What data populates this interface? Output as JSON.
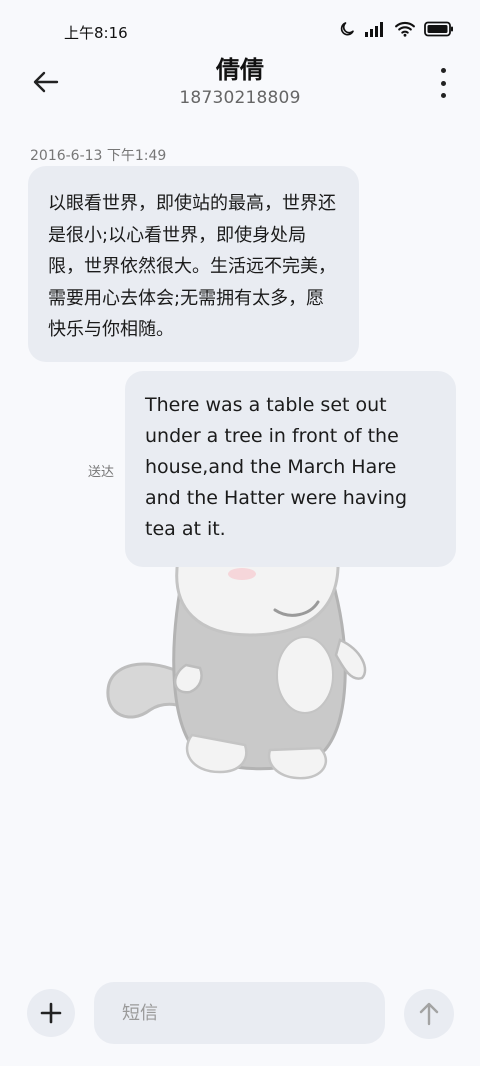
{
  "status_bar": {
    "time": "上午8:16",
    "icons": [
      "moon-icon",
      "signal-icon",
      "wifi-icon",
      "battery-icon"
    ]
  },
  "header": {
    "contact_name": "倩倩",
    "contact_number": "18730218809",
    "back_icon": "arrow-left-icon",
    "more_icon": "more-vertical-icon"
  },
  "messages": [
    {
      "direction": "incoming",
      "timestamp": "2016-6-13 下午1:49",
      "text": "以眼看世界，即使站的最高，世界还是很小;以心看世界，即使身处局限，世界依然很大。生活远不完美，需要用心去体会;无需拥有太多，愿快乐与你相随。"
    },
    {
      "direction": "outgoing",
      "status": "送达",
      "text": "There was a table set out under a tree in front of the house,and the March Hare and the Hatter were having tea at it."
    }
  ],
  "composer": {
    "add_icon": "plus-icon",
    "placeholder": "短信",
    "value": "",
    "send_icon": "arrow-up-icon"
  },
  "colors": {
    "background": "#f8f9fc",
    "bubble": "#e9ecf2",
    "text": "#1b1b1b",
    "muted": "#777777"
  }
}
